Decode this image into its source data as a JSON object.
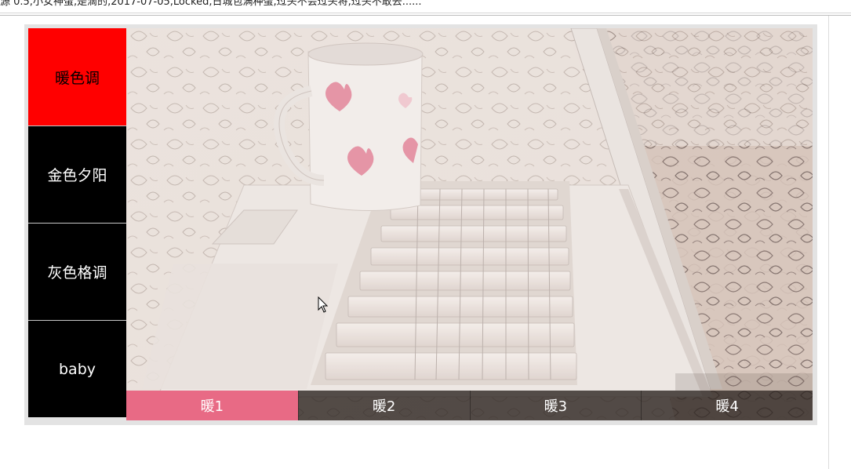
{
  "header": {
    "partial_text": "源 0.5,小女神蛋,是滴的,2017-07-05,Locked,日城包满种蛋,过头不会过头将,过头不敢去......"
  },
  "sidebar": {
    "items": [
      {
        "label": "暖色调",
        "active": true
      },
      {
        "label": "金色夕阳",
        "active": false
      },
      {
        "label": "灰色格调",
        "active": false
      },
      {
        "label": "baby",
        "active": false
      }
    ]
  },
  "thumbs": [
    {
      "label": "暖1",
      "active": true
    },
    {
      "label": "暖2",
      "active": false
    },
    {
      "label": "暖3",
      "active": false
    },
    {
      "label": "暖4",
      "active": false
    }
  ],
  "colors": {
    "sidebar_active": "#ff0000",
    "sidebar_bg": "#000000",
    "thumb_active": "#e86a85",
    "thumb_bg": "rgba(40,32,28,0.78)",
    "frame": "#e3e3e3"
  },
  "image": {
    "description_icon": "laptop-and-mug-photo"
  }
}
